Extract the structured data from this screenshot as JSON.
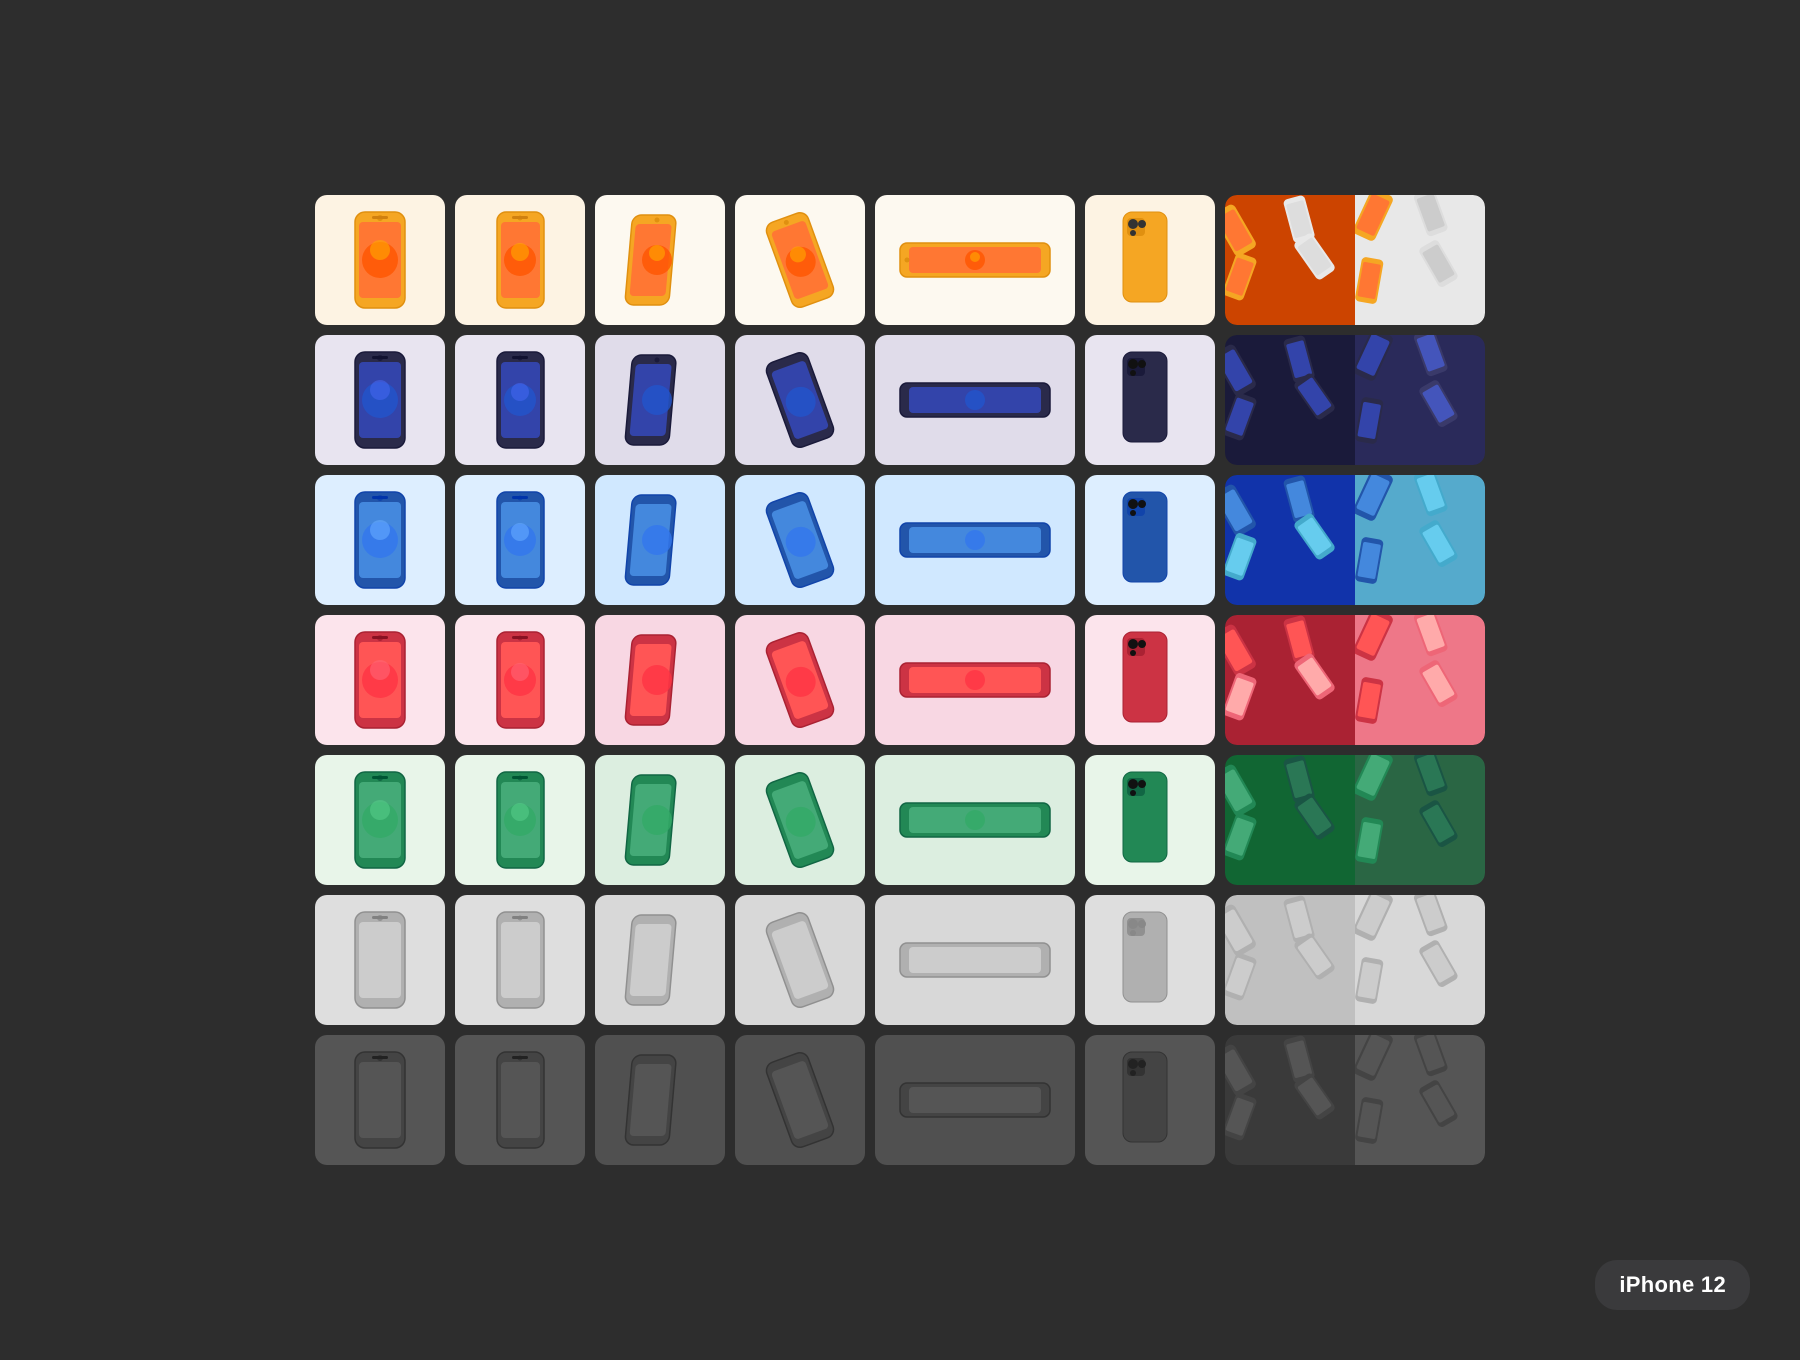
{
  "tooltip": {
    "label": "iPhone 12"
  },
  "rows": [
    {
      "id": "yellow",
      "bgColor": "#fdf3e3",
      "phoneColor": "#f5a623",
      "screenColor": "#ff6b35",
      "darkPattern": false,
      "patternColors": [
        "#f5a623",
        "#e8e8e8"
      ]
    },
    {
      "id": "purple",
      "bgColor": "#e8e4f0",
      "phoneColor": "#4a4a6a",
      "screenColor": "#6c63a8",
      "darkPattern": true,
      "patternColors": [
        "#2a2a4a",
        "#3a3a6a"
      ]
    },
    {
      "id": "blue",
      "bgColor": "#ddeeff",
      "phoneColor": "#2255aa",
      "screenColor": "#3388ff",
      "darkPattern": true,
      "patternColors": [
        "#1a3a8a",
        "#4499cc"
      ]
    },
    {
      "id": "pink",
      "bgColor": "#fce4ec",
      "phoneColor": "#cc3344",
      "screenColor": "#ff4444",
      "darkPattern": true,
      "patternColors": [
        "#aa2233",
        "#ee6677"
      ]
    },
    {
      "id": "green",
      "bgColor": "#e8f5e9",
      "phoneColor": "#228855",
      "screenColor": "#44aa66",
      "darkPattern": true,
      "patternColors": [
        "#1a6644",
        "#33aa66"
      ]
    },
    {
      "id": "lightgray",
      "bgColor": "#e0e0e0",
      "phoneColor": "#aaaaaa",
      "screenColor": "#cccccc",
      "darkPattern": false,
      "patternColors": [
        "#aaaaaa",
        "#cccccc"
      ]
    },
    {
      "id": "darkgray",
      "bgColor": "#555555",
      "phoneColor": "#444444",
      "screenColor": "#666666",
      "darkPattern": false,
      "patternColors": [
        "#444444",
        "#666666"
      ]
    }
  ]
}
